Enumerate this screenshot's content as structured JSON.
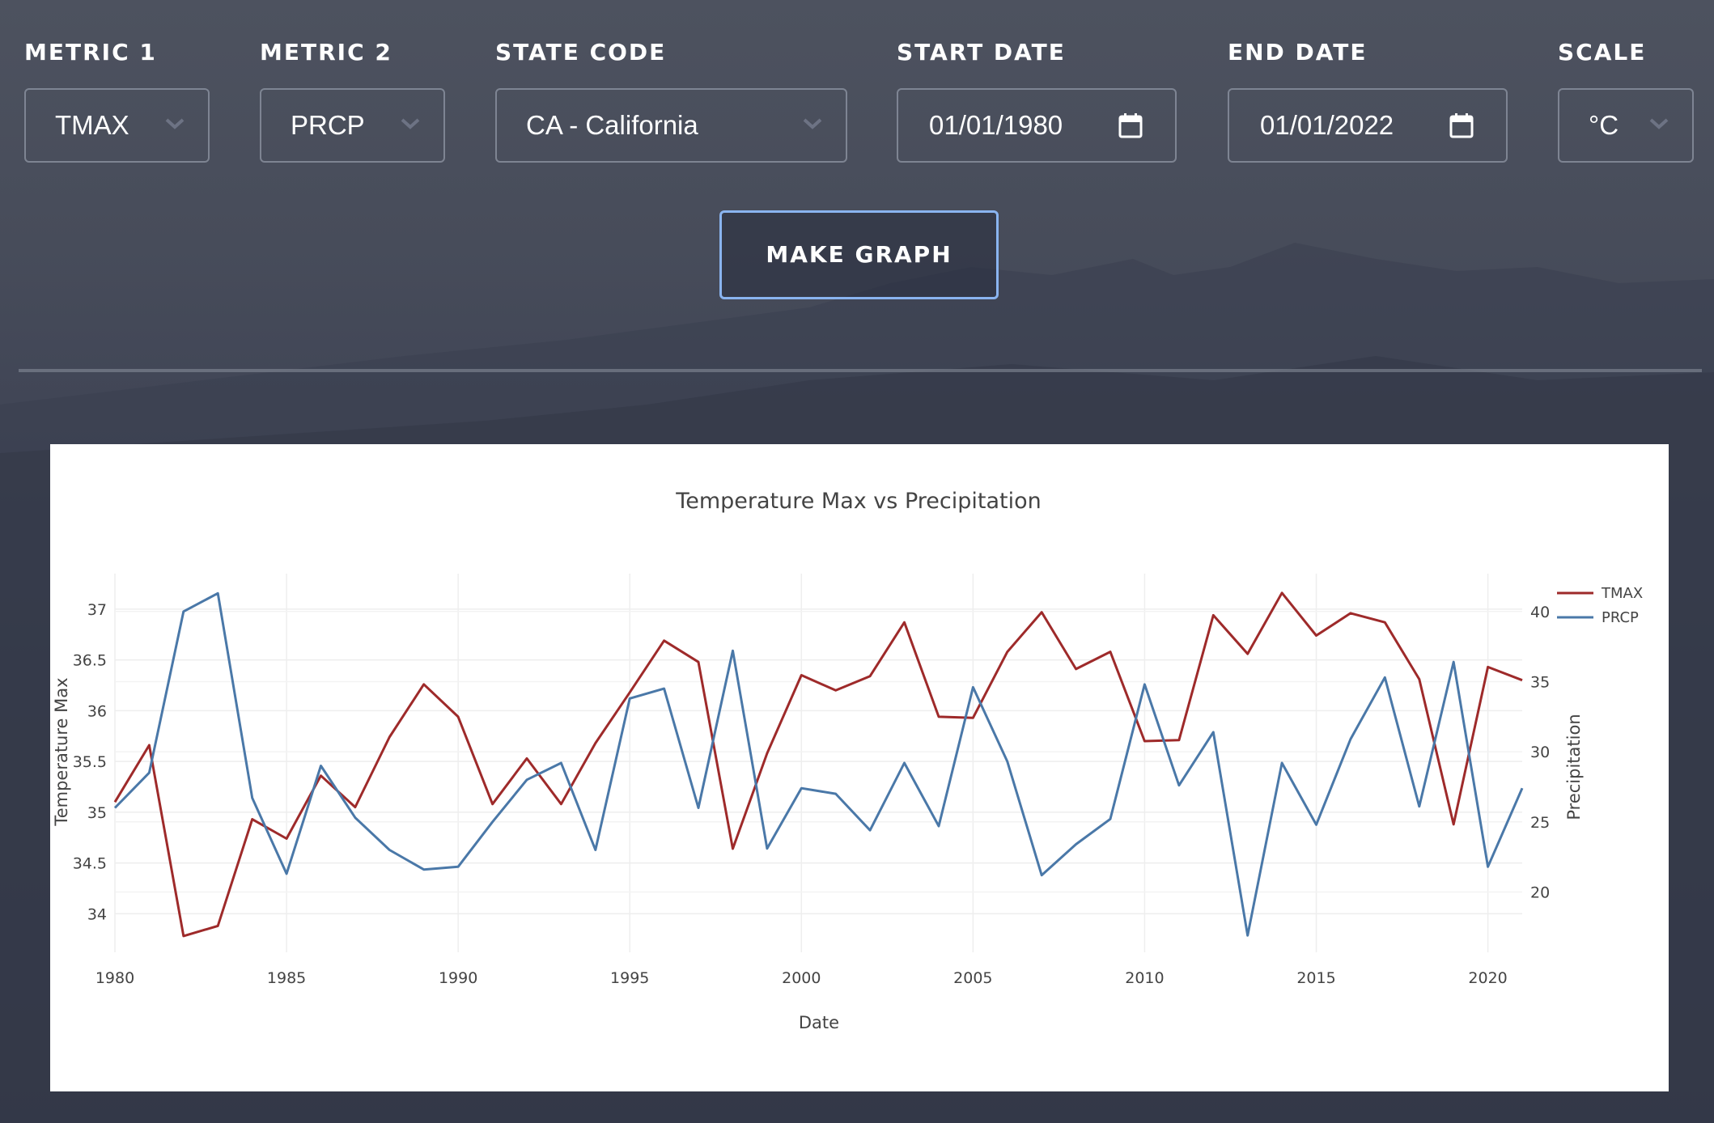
{
  "controls": {
    "metric1": {
      "label": "METRIC 1",
      "value": "TMAX"
    },
    "metric2": {
      "label": "METRIC 2",
      "value": "PRCP"
    },
    "state": {
      "label": "STATE CODE",
      "value": "CA - California"
    },
    "start_date": {
      "label": "START DATE",
      "value": "01/01/1980"
    },
    "end_date": {
      "label": "END DATE",
      "value": "01/01/2022"
    },
    "scale": {
      "label": "SCALE",
      "value": "°C"
    },
    "make_graph": "MAKE GRAPH"
  },
  "icons": {
    "dropdown": "chevron-down-icon",
    "date": "calendar-icon"
  },
  "chart_data": {
    "type": "line",
    "title": "Temperature Max vs Precipitation",
    "xlabel": "Date",
    "ylabel": "Temperature Max",
    "y2label": "Precipitation",
    "x": [
      1980,
      1981,
      1982,
      1983,
      1984,
      1985,
      1986,
      1987,
      1988,
      1989,
      1990,
      1991,
      1992,
      1993,
      1994,
      1995,
      1996,
      1997,
      1998,
      1999,
      2000,
      2001,
      2002,
      2003,
      2004,
      2005,
      2006,
      2007,
      2008,
      2009,
      2010,
      2011,
      2012,
      2013,
      2014,
      2015,
      2016,
      2017,
      2018,
      2019,
      2020,
      2021
    ],
    "xlim": [
      1980,
      2021
    ],
    "ylim": [
      33.62,
      37.35
    ],
    "y2lim": [
      15.7,
      42.7
    ],
    "xticks": [
      1980,
      1985,
      1990,
      1995,
      2000,
      2005,
      2010,
      2015,
      2020
    ],
    "yticks": [
      34,
      34.5,
      35,
      35.5,
      36,
      36.5,
      37
    ],
    "y2ticks": [
      20,
      25,
      30,
      35,
      40
    ],
    "series": [
      {
        "name": "TMAX",
        "axis": "y",
        "color": "#9e2a2a",
        "values": [
          35.1,
          35.66,
          33.78,
          33.88,
          34.93,
          34.74,
          35.36,
          35.05,
          35.74,
          36.26,
          35.94,
          35.08,
          35.53,
          35.08,
          35.68,
          36.18,
          36.69,
          36.48,
          34.64,
          35.58,
          36.35,
          36.2,
          36.34,
          36.87,
          35.94,
          35.93,
          36.58,
          36.97,
          36.41,
          36.58,
          35.7,
          35.71,
          36.94,
          36.56,
          37.16,
          36.74,
          36.96,
          36.87,
          36.31,
          34.88,
          36.43,
          36.3
        ]
      },
      {
        "name": "PRCP",
        "axis": "y2",
        "color": "#4a78a8",
        "values": [
          26,
          28.5,
          40,
          41.3,
          26.7,
          21.3,
          29,
          25.3,
          23,
          21.6,
          21.8,
          25,
          28,
          29.2,
          23,
          33.8,
          34.5,
          26,
          37.2,
          23.1,
          27.4,
          27,
          24.4,
          29.2,
          24.7,
          34.6,
          29.3,
          21.2,
          23.4,
          25.2,
          34.8,
          27.6,
          31.4,
          16.9,
          29.2,
          24.8,
          30.9,
          35.3,
          26.1,
          36.4,
          21.8,
          27.4
        ]
      }
    ],
    "legend_position": "top-right",
    "grid": true
  }
}
